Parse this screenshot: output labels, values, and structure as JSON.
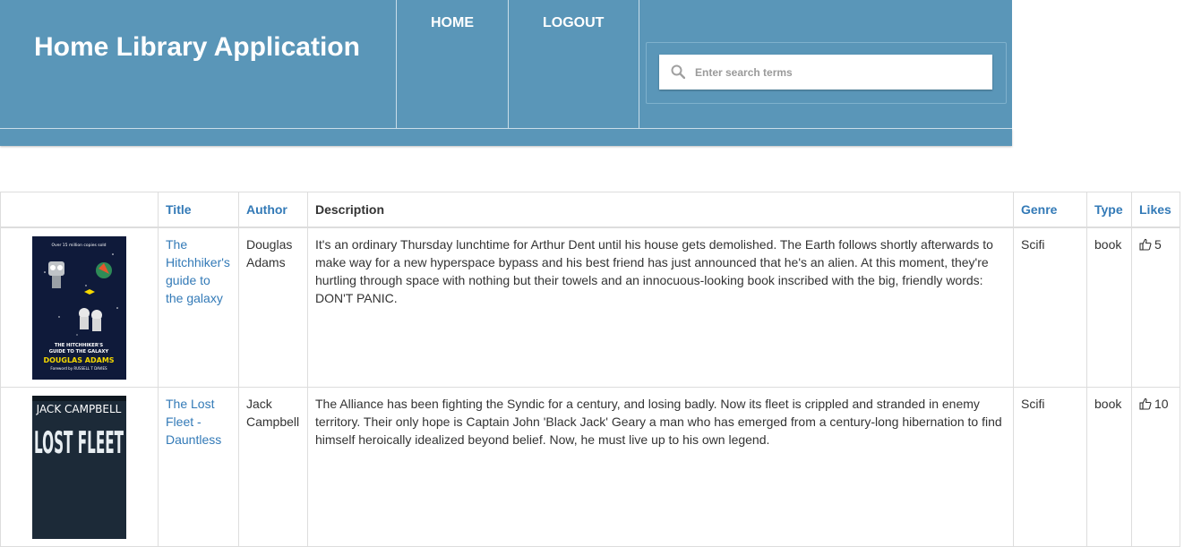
{
  "header": {
    "app_title": "Home Library Application",
    "nav": {
      "home": "HOME",
      "logout": "LOGOUT"
    },
    "search": {
      "placeholder": "Enter search terms",
      "value": ""
    },
    "colors": {
      "header_bg": "#5a96b8",
      "link": "#337ab7"
    }
  },
  "table": {
    "columns": {
      "cover": "",
      "title": "Title",
      "author": "Author",
      "description": "Description",
      "genre": "Genre",
      "type": "Type",
      "likes": "Likes"
    },
    "rows": [
      {
        "cover": {
          "top_text": "Over 15 million copies sold",
          "title_line1": "THE HITCHHIKER'S",
          "title_line2": "GUIDE TO THE GALAXY",
          "author": "DOUGLAS ADAMS",
          "foreword": "Foreword by RUSSELL T DAVIES"
        },
        "title": "The Hitchhiker's guide to the galaxy",
        "author": "Douglas Adams",
        "description": "It's an ordinary Thursday lunchtime for Arthur Dent until his house gets demolished. The Earth follows shortly afterwards to make way for a new hyperspace bypass and his best friend has just announced that he's an alien. At this moment, they're hurtling through space with nothing but their towels and an innocuous-looking book inscribed with the big, friendly words: DON'T PANIC.",
        "genre": "Scifi",
        "type": "book",
        "likes": "5",
        "like_icon": "thumbs-up-icon"
      },
      {
        "cover": {
          "author": "JACK CAMPBELL",
          "title": "LOST FLEET"
        },
        "title": "The Lost Fleet - Dauntless",
        "author": "Jack Campbell",
        "description": "The Alliance has been fighting the Syndic for a century, and losing badly. Now its fleet is crippled and stranded in enemy territory. Their only hope is Captain John 'Black Jack' Geary a man who has emerged from a century-long hibernation to find himself heroically idealized beyond belief. Now, he must live up to his own legend.",
        "genre": "Scifi",
        "type": "book",
        "likes": "10",
        "like_icon": "thumbs-up-icon"
      }
    ]
  }
}
